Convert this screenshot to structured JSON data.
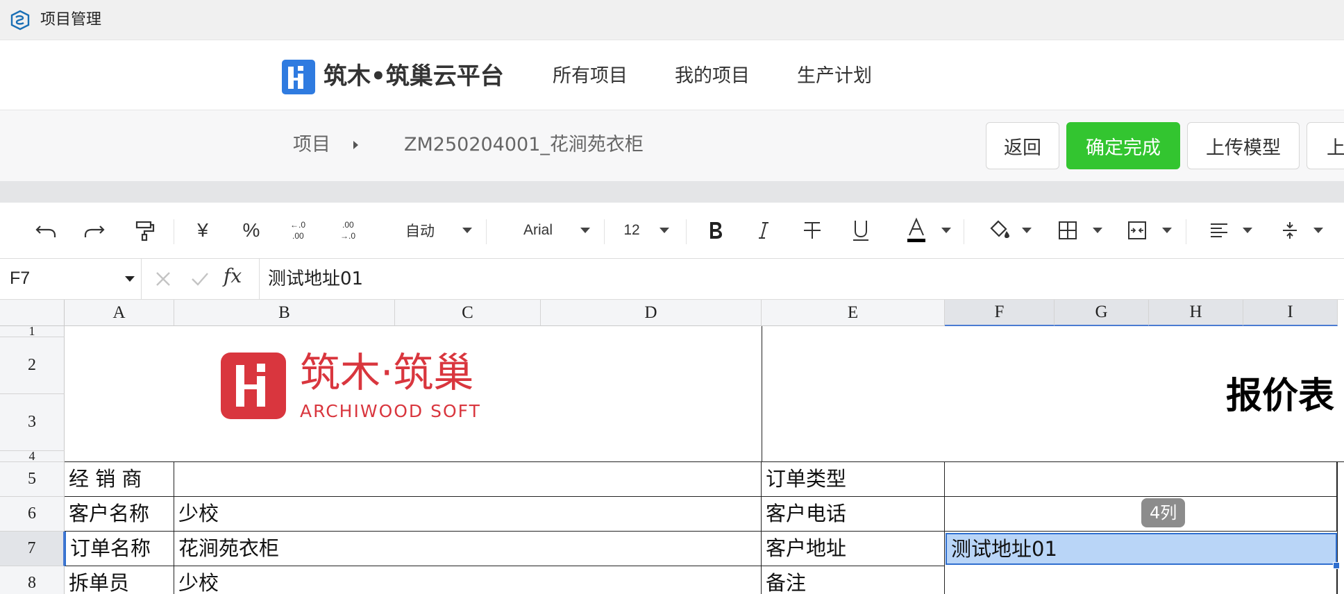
{
  "window": {
    "title": "项目管理"
  },
  "nav": {
    "brand": "筑木•筑巢云平台",
    "items": [
      {
        "label": "所有项目"
      },
      {
        "label": "我的项目"
      },
      {
        "label": "生产计划"
      }
    ]
  },
  "breadcrumb": {
    "root": "项目",
    "current": "ZM250204001_花涧苑衣柜"
  },
  "actions": {
    "back": "返回",
    "confirm": "确定完成",
    "upload_model": "上传模型",
    "more_partial": "上"
  },
  "toolbar": {
    "number_format": "自动",
    "font_name": "Arial",
    "font_size": "12",
    "currency_symbol": "¥",
    "percent_symbol": "%",
    "decrease_decimal": "←.0\n.00",
    "increase_decimal": ".00\n→.0"
  },
  "formula_bar": {
    "name_box": "F7",
    "fx_label": "fx",
    "value": "测试地址01"
  },
  "grid": {
    "columns": [
      "A",
      "B",
      "C",
      "D",
      "E",
      "F",
      "G",
      "H",
      "I"
    ],
    "rows": [
      "1",
      "2",
      "3",
      "4",
      "5",
      "6",
      "7",
      "8"
    ],
    "logo_cn": "筑木·筑巢",
    "logo_en": "ARCHIWOOD SOFT",
    "report_title": "报价表",
    "cells": {
      "a5": "经 销 商",
      "e5": "订单类型",
      "a6": "客户名称",
      "b6": "少校",
      "e6": "客户电话",
      "a7": "订单名称",
      "b7": "花涧苑衣柜",
      "e7": "客户地址",
      "f7": "测试地址01",
      "a8": "拆单员",
      "b8": "少校",
      "e8": "备注"
    },
    "selection_tooltip": "4列"
  },
  "colors": {
    "primary_green": "#33c530",
    "selection_blue": "#2f6fcf",
    "selection_fill": "#b9d5f7",
    "brand_red": "#d9363e",
    "logo_blue": "#2f7be0"
  }
}
